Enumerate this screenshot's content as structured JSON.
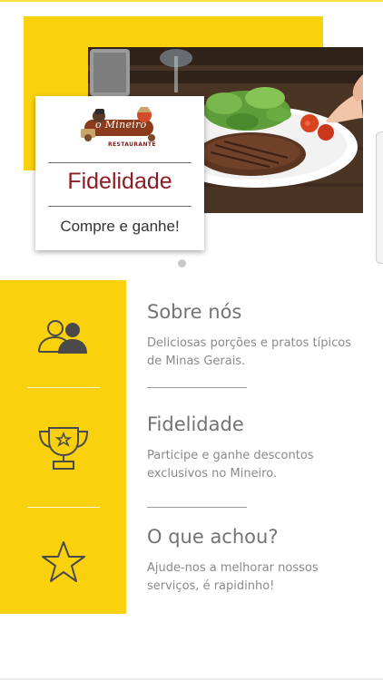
{
  "hero": {
    "brand_logo_text": "o Mineiro",
    "brand_logo_subtext": "RESTAURANTE",
    "title": "Fidelidade",
    "subtitle": "Compre e ganhe!",
    "carousel_pages": 1,
    "carousel_active": 1
  },
  "menu": {
    "items": [
      {
        "title": "Sobre nós",
        "description": "Deliciosas porções e pratos típicos de Minas Gerais.",
        "icon": "users-icon"
      },
      {
        "title": "Fidelidade",
        "description": "Participe e ganhe descontos exclusivos no Mineiro.",
        "icon": "trophy-icon"
      },
      {
        "title": "O que achou?",
        "description": "Ajude-nos a melhorar nossos serviços, é rapidinho!",
        "icon": "star-icon"
      }
    ]
  },
  "colors": {
    "accent_yellow": "#f9d20d",
    "title_red": "#8e1c24",
    "text_gray": "#737373",
    "icon_gray": "#4a4a4a"
  }
}
